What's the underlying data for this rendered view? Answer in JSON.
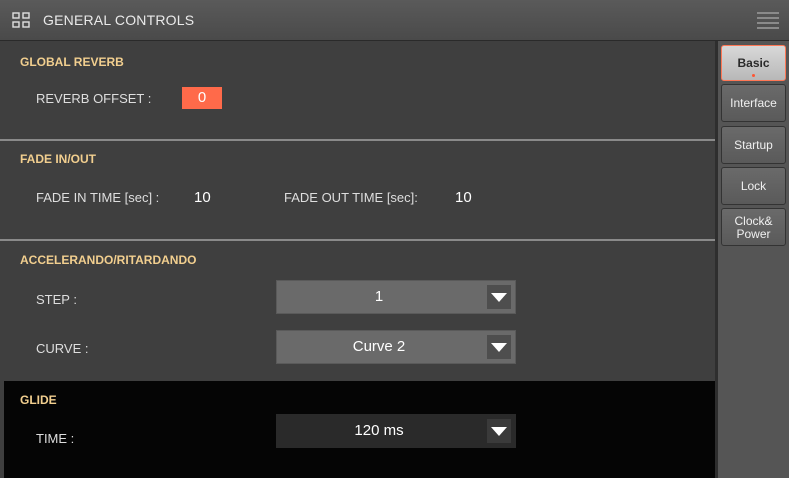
{
  "header": {
    "title": "GENERAL CONTROLS",
    "icon": "grid-icon",
    "menu_icon": "menu-icon"
  },
  "global_reverb": {
    "title": "GLOBAL REVERB",
    "offset_label": "REVERB OFFSET :",
    "offset_value": "0"
  },
  "fade": {
    "title": "FADE IN/OUT",
    "fade_in_label": "FADE IN TIME [sec] :",
    "fade_in_value": "10",
    "fade_out_label": "FADE OUT TIME [sec]:",
    "fade_out_value": "10"
  },
  "accel": {
    "title": "ACCELERANDO/RITARDANDO",
    "step_label": "STEP :",
    "step_value": "1",
    "curve_label": "CURVE :",
    "curve_value": "Curve 2"
  },
  "glide": {
    "title": "GLIDE",
    "time_label": "TIME :",
    "time_value": "120 ms"
  },
  "tabs": [
    {
      "label": "Basic",
      "active": true
    },
    {
      "label": "Interface",
      "active": false
    },
    {
      "label": "Startup",
      "active": false
    },
    {
      "label": "Lock",
      "active": false
    },
    {
      "label": "Clock& Power",
      "active": false
    }
  ],
  "colors": {
    "accent": "#ff6a4a",
    "section_title": "#f2cf8f"
  }
}
